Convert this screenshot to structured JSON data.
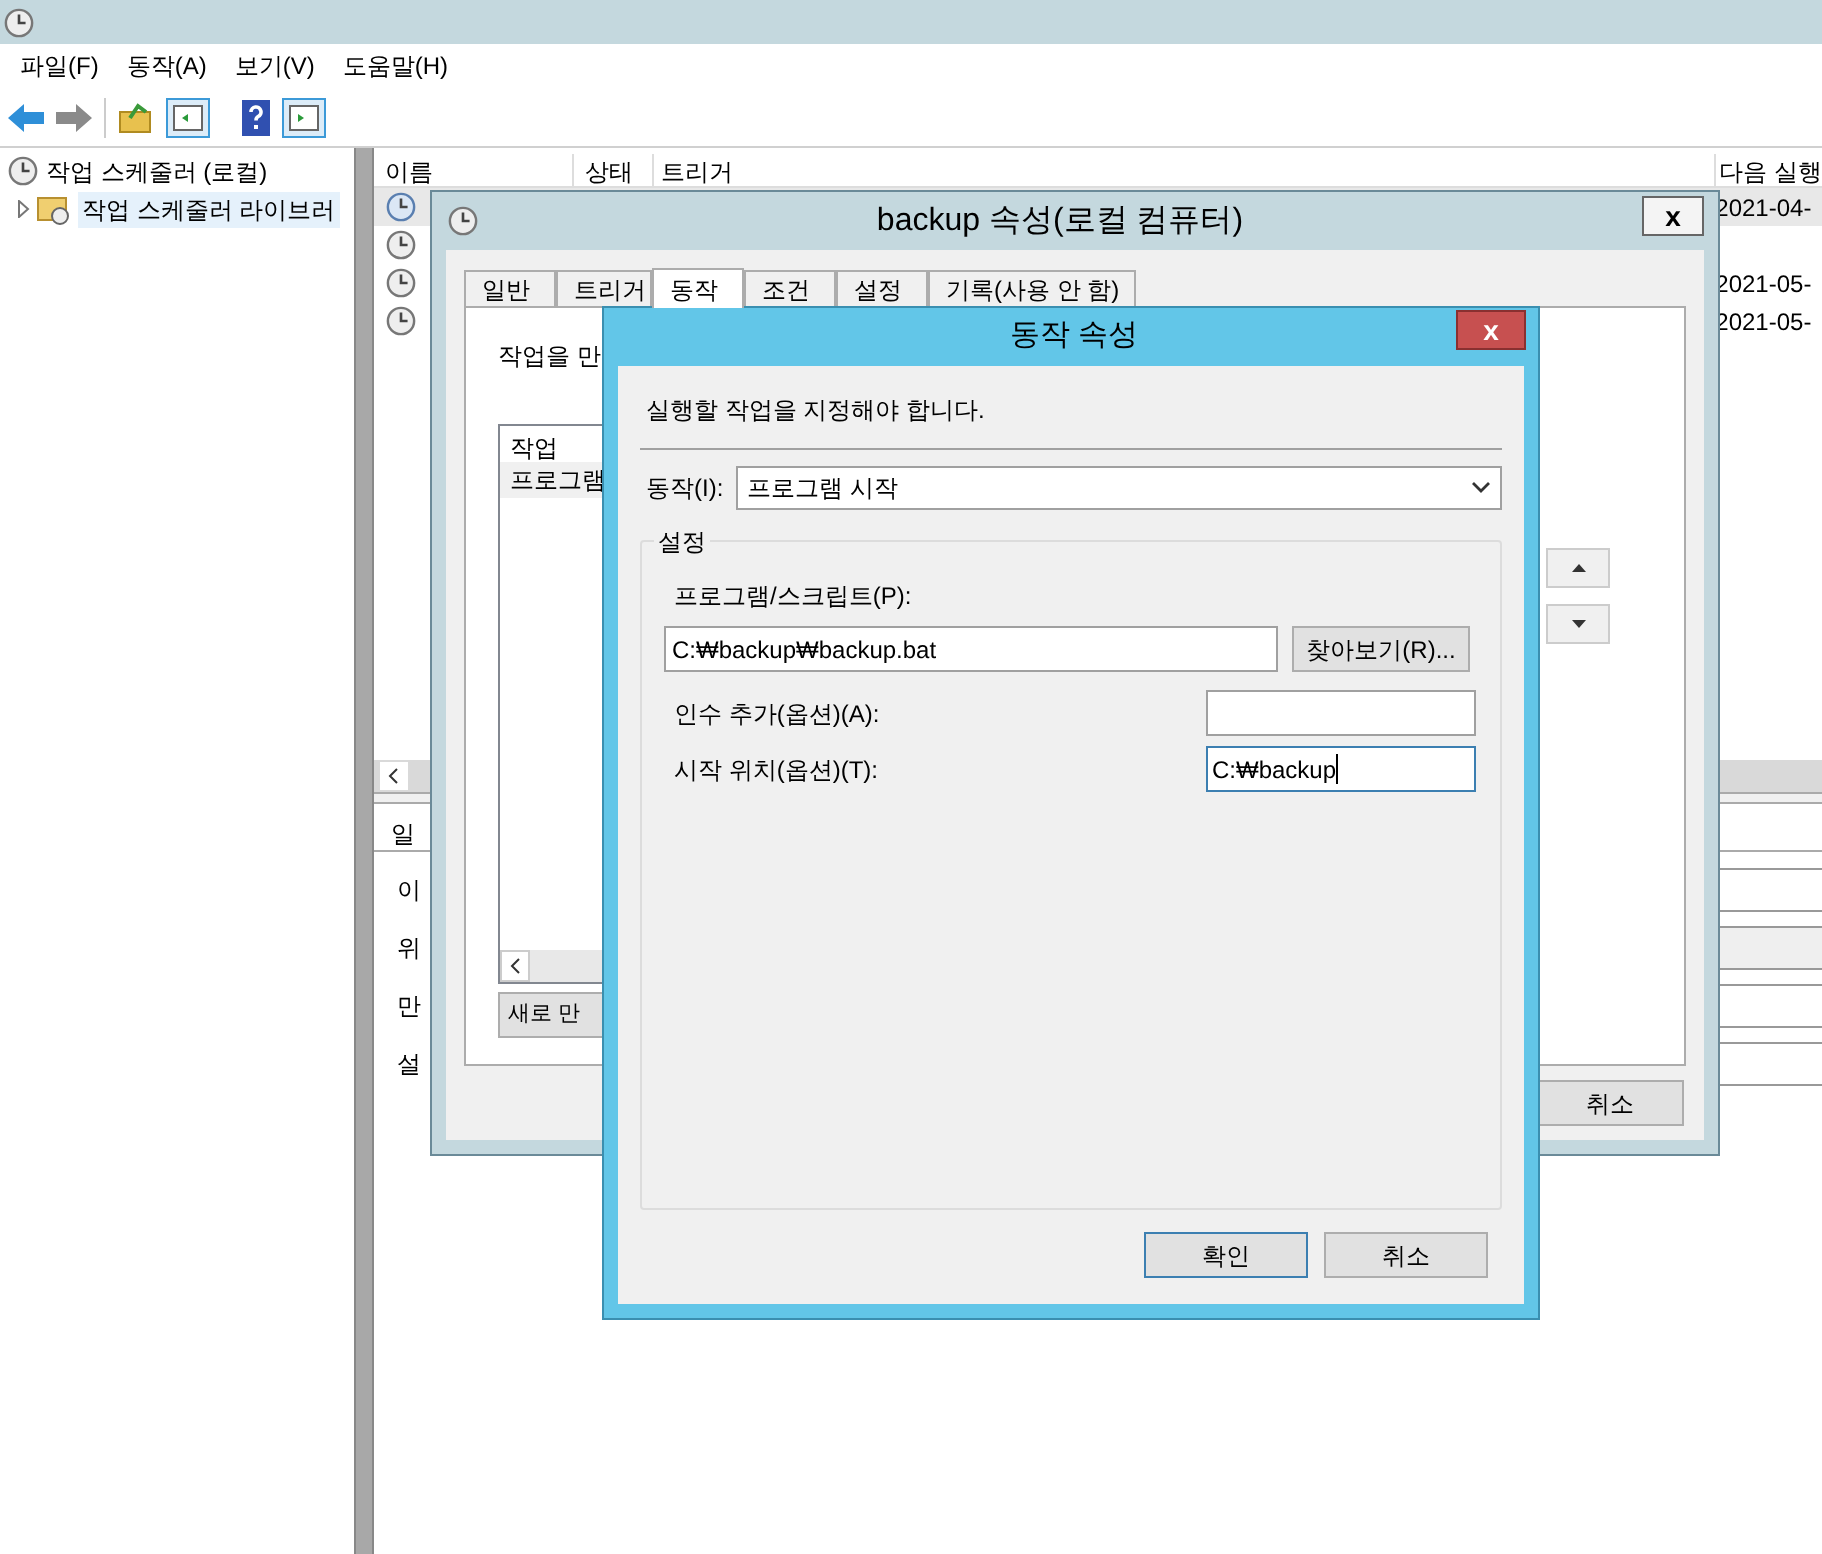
{
  "menu": [
    "파일(F)",
    "동작(A)",
    "보기(V)",
    "도움말(H)"
  ],
  "tree": [
    {
      "label": "작업 스케줄러 (로컬)",
      "children": [
        {
          "label": "작업 스케줄러 라이브러",
          "expanded": false
        }
      ]
    }
  ],
  "task_list": {
    "columns": [
      "이름",
      "상태",
      "트리거",
      "다음 실행"
    ],
    "rows": [
      {
        "selected": true,
        "next_run": "2021-04-"
      },
      {
        "selected": false
      },
      {
        "selected": false,
        "next_run": "2021-05-"
      },
      {
        "selected": false,
        "next_run": "2021-05-"
      }
    ]
  },
  "details": {
    "tab": "일",
    "labels": [
      "이",
      "위",
      "만",
      "설"
    ]
  },
  "properties_dialog": {
    "title": "backup 속성(로컬 컴퓨터)",
    "close": "x",
    "tabs": [
      {
        "label": "일반",
        "selected": false
      },
      {
        "label": "트리거",
        "selected": false
      },
      {
        "label": "동작",
        "selected": true
      },
      {
        "label": "조건",
        "selected": false
      },
      {
        "label": "설정",
        "selected": false
      },
      {
        "label": "기록(사용 안 함)",
        "selected": false
      }
    ],
    "intro": "작업을 만",
    "list_header": "작업",
    "list_rows": [
      "프로그램"
    ],
    "new_button": "새로 만",
    "cancel": "취소"
  },
  "action_dialog": {
    "title": "동작 속성",
    "close": "x",
    "intro": "실행할 작업을 지정해야 합니다.",
    "action_label": "동작(I):",
    "action_value": "프로그램 시작",
    "group": "설정",
    "program_label": "프로그램/스크립트(P):",
    "program_value": "C:₩backup₩backup.bat",
    "browse": "찾아보기(R)...",
    "args_label": "인수 추가(옵션)(A):",
    "start_label": "시작 위치(옵션)(T):",
    "start_value": "C:₩backup",
    "ok": "확인",
    "cancel": "취소"
  }
}
